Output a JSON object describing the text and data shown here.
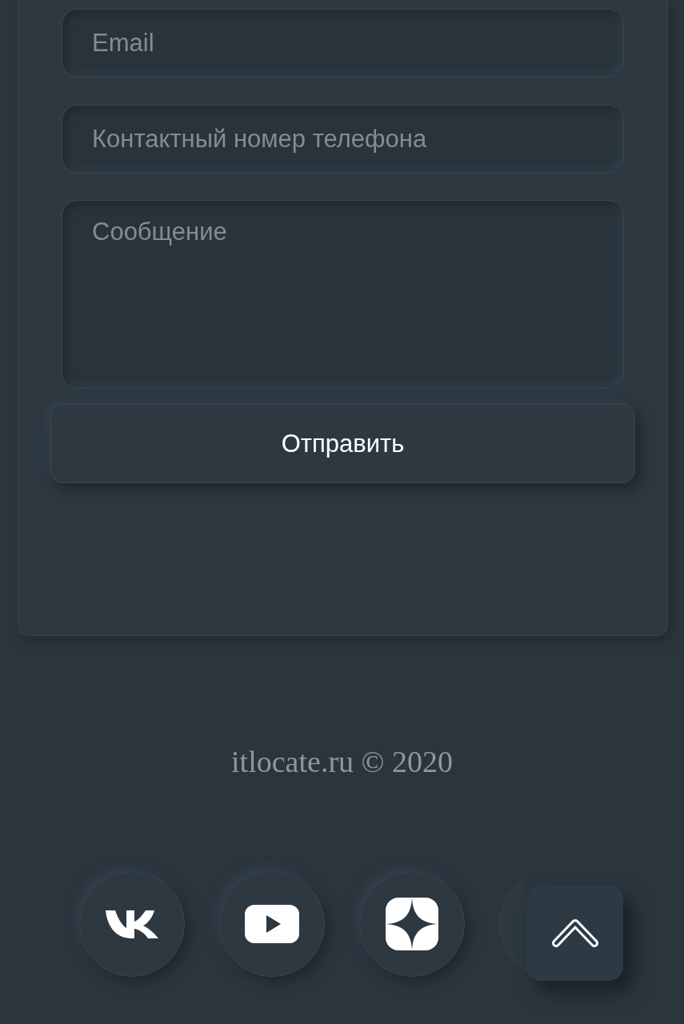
{
  "contact_form": {
    "fields": [
      {
        "kind": "input",
        "placeholder": "Email"
      },
      {
        "kind": "input",
        "placeholder": "Контактный номер телефона"
      },
      {
        "kind": "textarea",
        "placeholder": "Сообщение"
      }
    ],
    "submit_button": {
      "label": "Отправить"
    }
  },
  "footer": {
    "copyright": "itlocate.ru © 2020",
    "social_links": [
      {
        "kind": "vk"
      },
      {
        "kind": "video"
      },
      {
        "kind": "star"
      },
      {
        "kind": "blank"
      }
    ]
  }
}
